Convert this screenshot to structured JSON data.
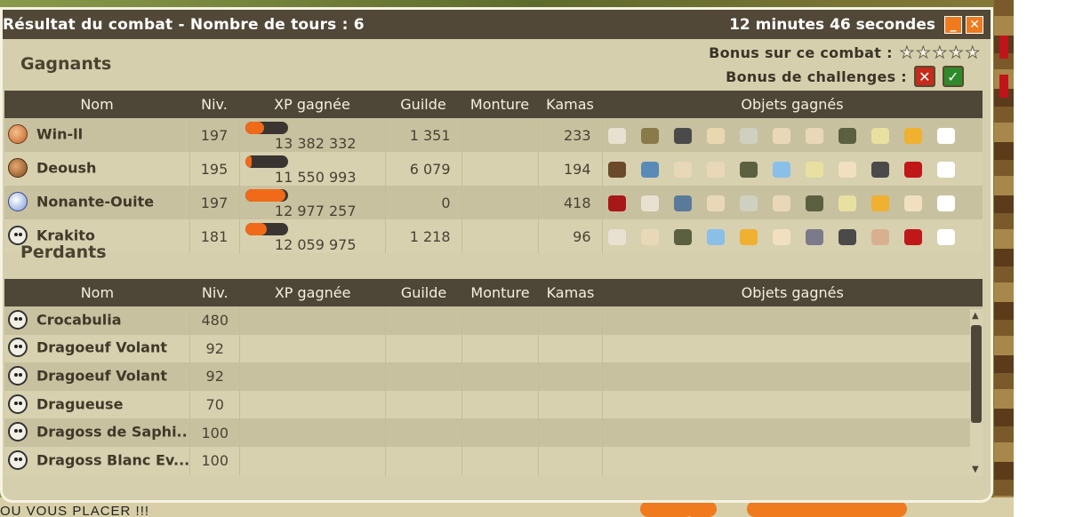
{
  "window": {
    "title": "Résultat du combat - Nombre de tours : 6",
    "timer": "12 minutes 46 secondes",
    "minimize": "_",
    "close": "✕"
  },
  "bonus": {
    "combat_label": "Bonus sur ce combat :",
    "combat_stars": 0,
    "challenges_label": "Bonus de challenges :",
    "challenges": [
      "failed",
      "success"
    ]
  },
  "columns": [
    "Nom",
    "Niv.",
    "XP gagnée",
    "Guilde",
    "Monture",
    "Kamas",
    "Objets gagnés"
  ],
  "winners": {
    "title": "Gagnants",
    "rows": [
      {
        "name": "Win-ll",
        "avatar": "orange-hair-character",
        "level": "197",
        "xp_progress": 0.45,
        "xp": "13 382 332",
        "guild": "1 351",
        "mount": "",
        "kamas": "233",
        "items": [
          "#e8e0d0",
          "#8a7a4a",
          "#4a4a4a",
          "#e8d8b0",
          "#d0d0c0",
          "#e8d8b8",
          "#e8d8b8",
          "#5a6040",
          "#e8e0a0",
          "#f0b030",
          "#ffffff"
        ]
      },
      {
        "name": "Deoush",
        "avatar": "brown-hair-character",
        "level": "195",
        "xp_progress": 0.15,
        "xp": "11 550 993",
        "guild": "6 079",
        "mount": "",
        "kamas": "194",
        "items": [
          "#6a4a2a",
          "#5a8ab8",
          "#e8d8b8",
          "#e8d8b8",
          "#5a6040",
          "#8ac0e8",
          "#e8e0a0",
          "#f0e0c0",
          "#4a4a4a",
          "#c01818",
          "#ffffff"
        ]
      },
      {
        "name": "Nonante-Ouite",
        "avatar": "white-hat-character",
        "level": "197",
        "xp_progress": 0.95,
        "xp": "12 977 257",
        "guild": "0",
        "mount": "",
        "kamas": "418",
        "items": [
          "#a81818",
          "#e8e0d0",
          "#5a7a9a",
          "#e8d8b8",
          "#d0d0c0",
          "#e8d8b8",
          "#5a6040",
          "#e8e0a0",
          "#f0b030",
          "#f0e0c0",
          "#ffffff"
        ]
      },
      {
        "name": "Krakito",
        "avatar": "skull",
        "level": "181",
        "xp_progress": 0.5,
        "xp": "12 059 975",
        "guild": "1 218",
        "mount": "",
        "kamas": "96",
        "items": [
          "#e8e0d0",
          "#e8d8b8",
          "#5a6040",
          "#8ac0e8",
          "#f0b030",
          "#f0e0c0",
          "#7a7a8a",
          "#4a4a4a",
          "#d8b090",
          "#c01818",
          "#ffffff"
        ]
      }
    ]
  },
  "losers": {
    "title": "Perdants",
    "rows": [
      {
        "name": "Crocabulia",
        "level": "480"
      },
      {
        "name": "Dragoeuf Volant",
        "level": "92"
      },
      {
        "name": "Dragoeuf Volant",
        "level": "92"
      },
      {
        "name": "Dragueuse",
        "level": "70"
      },
      {
        "name": "Dragoss de Saphi..",
        "level": "100"
      },
      {
        "name": "Dragoss Blanc Ev...",
        "level": "100"
      }
    ]
  },
  "background": {
    "bottom_text": "OU VOUS PLACER !!!"
  }
}
